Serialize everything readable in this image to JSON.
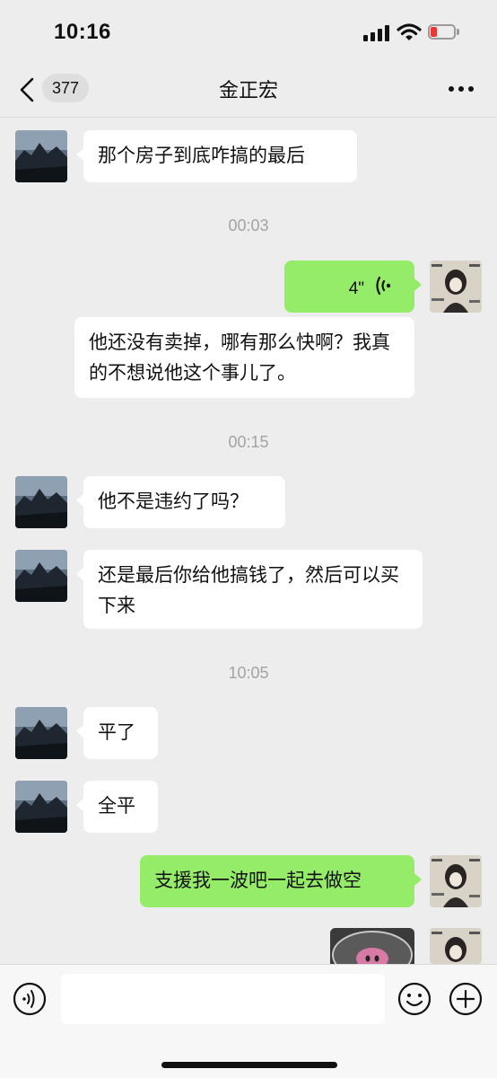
{
  "status": {
    "time": "10:16"
  },
  "header": {
    "unread_count": "377",
    "title": "金正宏"
  },
  "messages": [
    {
      "text": "那个房子到底咋搞的最后"
    },
    {
      "time": "00:03"
    },
    {
      "voice_duration": "4\""
    },
    {
      "text": "他还没有卖掉，哪有那么快啊？我真的不想说他这个事儿了。"
    },
    {
      "time": "00:15"
    },
    {
      "text": "他不是违约了吗？"
    },
    {
      "text": "还是最后你给他搞钱了，然后可以买下来"
    },
    {
      "time": "10:05"
    },
    {
      "text": "平了"
    },
    {
      "text": "全平"
    },
    {
      "text": "支援我一波吧一起去做空"
    }
  ],
  "input": {
    "placeholder": ""
  },
  "colors": {
    "background": "#ededed",
    "outgoing_bubble": "#95ec69",
    "incoming_bubble": "#ffffff",
    "battery_low": "#ee3333"
  },
  "icons": [
    "back-icon",
    "more-icon",
    "voice-message-icon",
    "voice-toggle-icon",
    "emoji-icon",
    "plus-icon"
  ]
}
